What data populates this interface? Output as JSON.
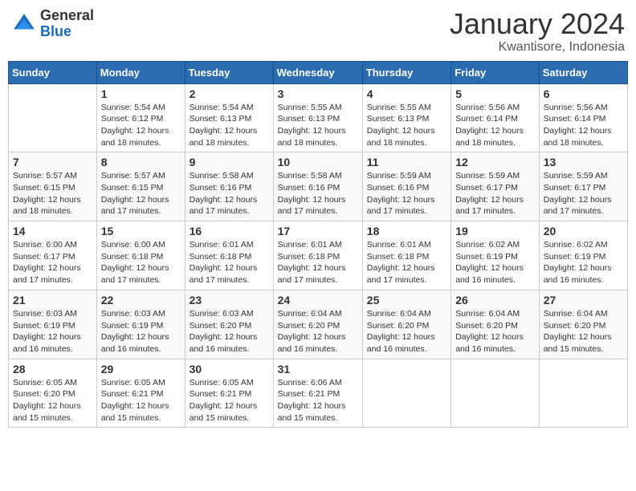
{
  "header": {
    "logo_general": "General",
    "logo_blue": "Blue",
    "month_year": "January 2024",
    "location": "Kwantisore, Indonesia"
  },
  "calendar": {
    "headers": [
      "Sunday",
      "Monday",
      "Tuesday",
      "Wednesday",
      "Thursday",
      "Friday",
      "Saturday"
    ],
    "weeks": [
      [
        {
          "day": "",
          "info": ""
        },
        {
          "day": "1",
          "info": "Sunrise: 5:54 AM\nSunset: 6:12 PM\nDaylight: 12 hours\nand 18 minutes."
        },
        {
          "day": "2",
          "info": "Sunrise: 5:54 AM\nSunset: 6:13 PM\nDaylight: 12 hours\nand 18 minutes."
        },
        {
          "day": "3",
          "info": "Sunrise: 5:55 AM\nSunset: 6:13 PM\nDaylight: 12 hours\nand 18 minutes."
        },
        {
          "day": "4",
          "info": "Sunrise: 5:55 AM\nSunset: 6:13 PM\nDaylight: 12 hours\nand 18 minutes."
        },
        {
          "day": "5",
          "info": "Sunrise: 5:56 AM\nSunset: 6:14 PM\nDaylight: 12 hours\nand 18 minutes."
        },
        {
          "day": "6",
          "info": "Sunrise: 5:56 AM\nSunset: 6:14 PM\nDaylight: 12 hours\nand 18 minutes."
        }
      ],
      [
        {
          "day": "7",
          "info": "Sunrise: 5:57 AM\nSunset: 6:15 PM\nDaylight: 12 hours\nand 18 minutes."
        },
        {
          "day": "8",
          "info": "Sunrise: 5:57 AM\nSunset: 6:15 PM\nDaylight: 12 hours\nand 17 minutes."
        },
        {
          "day": "9",
          "info": "Sunrise: 5:58 AM\nSunset: 6:16 PM\nDaylight: 12 hours\nand 17 minutes."
        },
        {
          "day": "10",
          "info": "Sunrise: 5:58 AM\nSunset: 6:16 PM\nDaylight: 12 hours\nand 17 minutes."
        },
        {
          "day": "11",
          "info": "Sunrise: 5:59 AM\nSunset: 6:16 PM\nDaylight: 12 hours\nand 17 minutes."
        },
        {
          "day": "12",
          "info": "Sunrise: 5:59 AM\nSunset: 6:17 PM\nDaylight: 12 hours\nand 17 minutes."
        },
        {
          "day": "13",
          "info": "Sunrise: 5:59 AM\nSunset: 6:17 PM\nDaylight: 12 hours\nand 17 minutes."
        }
      ],
      [
        {
          "day": "14",
          "info": "Sunrise: 6:00 AM\nSunset: 6:17 PM\nDaylight: 12 hours\nand 17 minutes."
        },
        {
          "day": "15",
          "info": "Sunrise: 6:00 AM\nSunset: 6:18 PM\nDaylight: 12 hours\nand 17 minutes."
        },
        {
          "day": "16",
          "info": "Sunrise: 6:01 AM\nSunset: 6:18 PM\nDaylight: 12 hours\nand 17 minutes."
        },
        {
          "day": "17",
          "info": "Sunrise: 6:01 AM\nSunset: 6:18 PM\nDaylight: 12 hours\nand 17 minutes."
        },
        {
          "day": "18",
          "info": "Sunrise: 6:01 AM\nSunset: 6:18 PM\nDaylight: 12 hours\nand 17 minutes."
        },
        {
          "day": "19",
          "info": "Sunrise: 6:02 AM\nSunset: 6:19 PM\nDaylight: 12 hours\nand 16 minutes."
        },
        {
          "day": "20",
          "info": "Sunrise: 6:02 AM\nSunset: 6:19 PM\nDaylight: 12 hours\nand 16 minutes."
        }
      ],
      [
        {
          "day": "21",
          "info": "Sunrise: 6:03 AM\nSunset: 6:19 PM\nDaylight: 12 hours\nand 16 minutes."
        },
        {
          "day": "22",
          "info": "Sunrise: 6:03 AM\nSunset: 6:19 PM\nDaylight: 12 hours\nand 16 minutes."
        },
        {
          "day": "23",
          "info": "Sunrise: 6:03 AM\nSunset: 6:20 PM\nDaylight: 12 hours\nand 16 minutes."
        },
        {
          "day": "24",
          "info": "Sunrise: 6:04 AM\nSunset: 6:20 PM\nDaylight: 12 hours\nand 16 minutes."
        },
        {
          "day": "25",
          "info": "Sunrise: 6:04 AM\nSunset: 6:20 PM\nDaylight: 12 hours\nand 16 minutes."
        },
        {
          "day": "26",
          "info": "Sunrise: 6:04 AM\nSunset: 6:20 PM\nDaylight: 12 hours\nand 16 minutes."
        },
        {
          "day": "27",
          "info": "Sunrise: 6:04 AM\nSunset: 6:20 PM\nDaylight: 12 hours\nand 15 minutes."
        }
      ],
      [
        {
          "day": "28",
          "info": "Sunrise: 6:05 AM\nSunset: 6:20 PM\nDaylight: 12 hours\nand 15 minutes."
        },
        {
          "day": "29",
          "info": "Sunrise: 6:05 AM\nSunset: 6:21 PM\nDaylight: 12 hours\nand 15 minutes."
        },
        {
          "day": "30",
          "info": "Sunrise: 6:05 AM\nSunset: 6:21 PM\nDaylight: 12 hours\nand 15 minutes."
        },
        {
          "day": "31",
          "info": "Sunrise: 6:06 AM\nSunset: 6:21 PM\nDaylight: 12 hours\nand 15 minutes."
        },
        {
          "day": "",
          "info": ""
        },
        {
          "day": "",
          "info": ""
        },
        {
          "day": "",
          "info": ""
        }
      ]
    ]
  }
}
